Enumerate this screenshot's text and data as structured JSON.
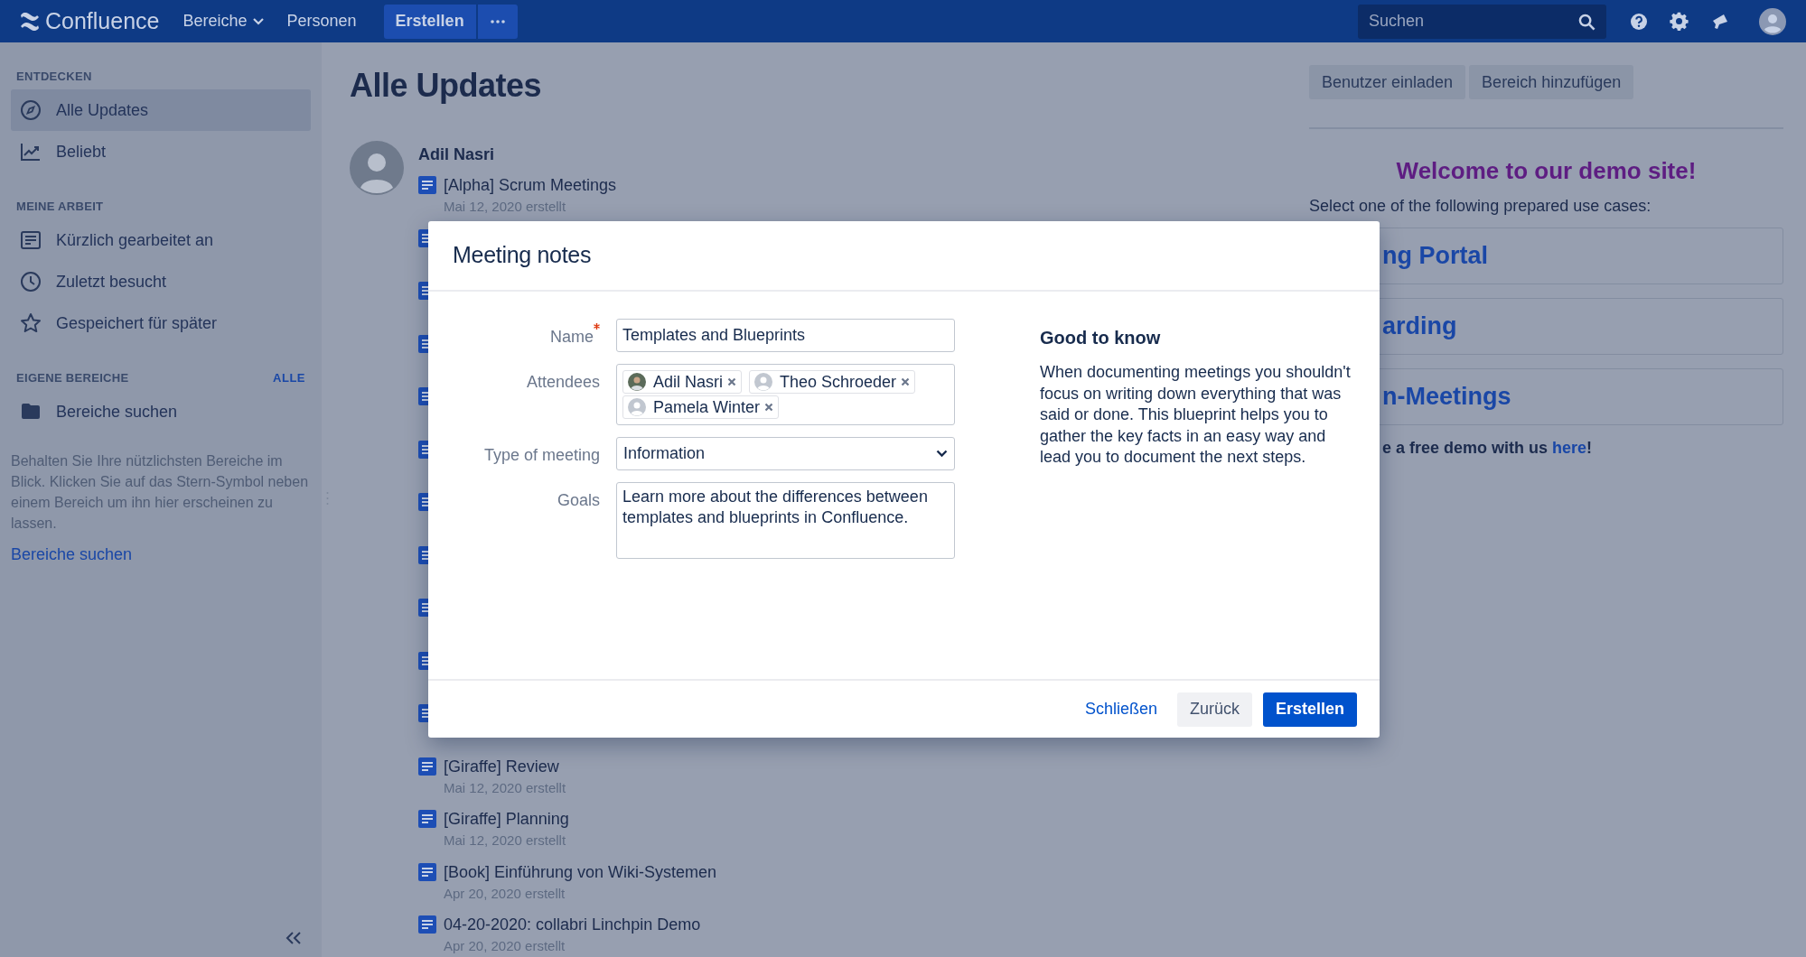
{
  "top_bar": {
    "logo": "Confluence",
    "nav": [
      {
        "label": "Bereiche",
        "kind": "dropdown"
      },
      {
        "label": "Personen",
        "kind": "link"
      }
    ],
    "create_button": "Erstellen",
    "search": {
      "placeholder": "Suchen"
    }
  },
  "sidebar": {
    "sections": [
      {
        "heading": "ENTDECKEN",
        "items": [
          {
            "label": "Alle Updates",
            "selected": true
          },
          {
            "label": "Beliebt",
            "selected": false
          }
        ]
      },
      {
        "heading": "MEINE ARBEIT",
        "items": [
          {
            "label": "Kürzlich gearbeitet an",
            "selected": false
          },
          {
            "label": "Zuletzt besucht",
            "selected": false
          },
          {
            "label": "Gespeichert für später",
            "selected": false
          }
        ]
      },
      {
        "heading": "EIGENE BEREICHE",
        "action": "ALLE",
        "items": [
          {
            "label": "Bereiche suchen",
            "selected": false
          }
        ]
      }
    ],
    "hint": "Behalten Sie Ihre nützlichsten Bereiche im Blick. Klicken Sie auf das Stern-Symbol neben einem Bereich um ihn hier erscheinen zu lassen.",
    "link": "Bereiche suchen"
  },
  "main": {
    "title": "Alle Updates",
    "author": "Adil Nasri",
    "feed": [
      {
        "kind": "page",
        "title": "[Alpha] Scrum Meetings",
        "date": "Mai 12, 2020 erstellt"
      },
      {
        "kind": "covered"
      },
      {
        "kind": "covered"
      },
      {
        "kind": "covered"
      },
      {
        "kind": "covered"
      },
      {
        "kind": "covered"
      },
      {
        "kind": "covered"
      },
      {
        "kind": "covered"
      },
      {
        "kind": "covered"
      },
      {
        "kind": "covered"
      },
      {
        "kind": "covered"
      },
      {
        "kind": "page",
        "title": "[Giraffe] Review",
        "date": "Mai 12, 2020 erstellt"
      },
      {
        "kind": "page",
        "title": "[Giraffe] Planning",
        "date": "Mai 12, 2020 erstellt"
      },
      {
        "kind": "page",
        "title": "[Book] Einführung von Wiki-Systemen",
        "date": "Apr 20, 2020 erstellt"
      },
      {
        "kind": "page",
        "title": "04-20-2020: collabri Linchpin Demo",
        "date": "Apr 20, 2020 erstellt"
      }
    ]
  },
  "right_panel": {
    "buttons": [
      "Benutzer einladen",
      "Bereich hinzufügen"
    ],
    "welcome": "Welcome to our demo site!",
    "intro": "Select one of the following prepared use cases:",
    "cards": [
      "ng Portal",
      "arding",
      "n-Meetings"
    ],
    "note": {
      "text": "e a free demo with us ",
      "link": "here",
      "after": "!"
    }
  },
  "dialog": {
    "title": "Meeting notes",
    "fields": [
      {
        "kind": "text",
        "label": "Name",
        "required": true,
        "value": "Templates and Blueprints"
      },
      {
        "kind": "tags",
        "label": "Attendees",
        "required": false,
        "tags": [
          {
            "label": "Adil Nasri",
            "photo": true
          },
          {
            "label": "Theo Schroeder",
            "photo": false
          },
          {
            "label": "Pamela Winter",
            "photo": false
          }
        ]
      },
      {
        "kind": "select",
        "label": "Type of meeting",
        "required": false,
        "value": "Information"
      },
      {
        "kind": "textarea",
        "label": "Goals",
        "required": false,
        "value": "Learn more about the differences between templates and blueprints in Confluence."
      }
    ],
    "info": {
      "heading": "Good to know",
      "text": "When documenting meetings you shouldn't focus on writing down everything that was said or done. This blueprint helps you to gather the key facts in an easy way and lead you to document the next steps."
    },
    "buttons": [
      {
        "label": "Schließen",
        "kind": "link"
      },
      {
        "label": "Zurück",
        "kind": "secondary"
      },
      {
        "label": "Erstellen",
        "kind": "primary"
      }
    ]
  }
}
